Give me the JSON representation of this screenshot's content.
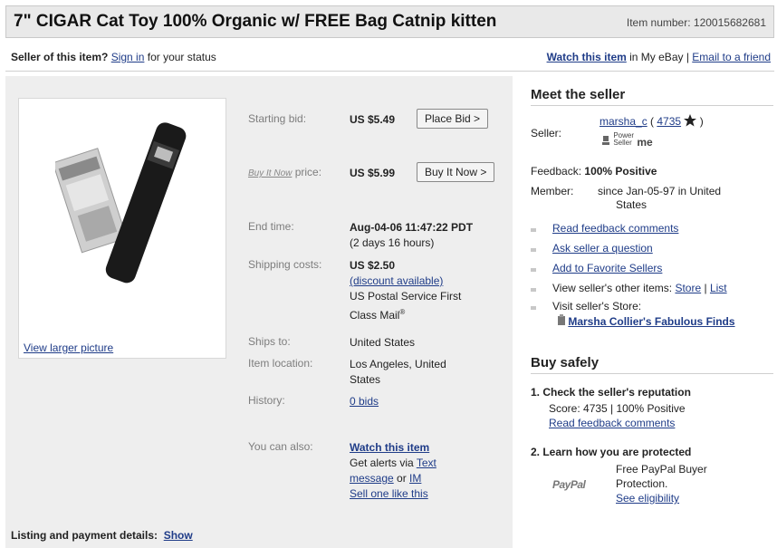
{
  "header": {
    "title": "7\" CIGAR Cat Toy 100% Organic w/ FREE Bag Catnip kitten",
    "item_number_label": "Item number:",
    "item_number": "120015682681"
  },
  "status_bar": {
    "seller_prompt": "Seller of this item?",
    "sign_in": "Sign in",
    "status_suffix": " for your status",
    "watch_link": "Watch this item",
    "watch_suffix": " in My eBay | ",
    "email_link": "Email to a friend"
  },
  "photo": {
    "view_larger": "View larger picture"
  },
  "listing": {
    "starting_bid_label": "Starting bid:",
    "starting_bid": "US $5.49",
    "place_bid": "Place Bid >",
    "buy_it_now_logo": "Buy It Now",
    "price_label": "price:",
    "price": "US $5.99",
    "buy_it_now_button": "Buy It Now >",
    "end_time_label": "End time:",
    "end_time": "Aug-04-06 11:47:22 PDT",
    "time_left": "(2 days 16 hours)",
    "shipping_label": "Shipping costs:",
    "shipping_cost": "US $2.50",
    "discount_link": "(discount available)",
    "shipping_service_1": "US Postal Service First",
    "shipping_service_2": "Class Mail",
    "registered_mark": "®",
    "ships_to_label": "Ships to:",
    "ships_to": "United States",
    "location_label": "Item location:",
    "location_1": "Los Angeles, United",
    "location_2": "States",
    "history_label": "History:",
    "bids_link": "0 bids",
    "you_can_also_label": "You can also:",
    "watch_link": "Watch this item",
    "alerts_text": "Get alerts via ",
    "text_link": "Text",
    "message_link": "message",
    "or_text": " or ",
    "im_link": "IM",
    "sell_one_link": "Sell one like this"
  },
  "details": {
    "label": "Listing and payment details:",
    "show_link": "Show"
  },
  "meet_seller": {
    "heading": "Meet the seller",
    "seller_label": "Seller:",
    "seller_name": "marsha_c",
    "seller_score": "4735",
    "power_seller_1": "Power",
    "power_seller_2": "Seller",
    "me_badge": "me",
    "feedback_label": "Feedback:",
    "feedback_value": "100% Positive",
    "member_label": "Member:",
    "member_value_1": "since Jan-05-97 in United",
    "member_value_2": "States",
    "read_feedback": "Read feedback comments",
    "ask_question": "Ask seller a question",
    "add_favorite": "Add to Favorite Sellers",
    "other_items": "View seller's other items: ",
    "store_link": "Store",
    "list_link": "List",
    "visit_store": "Visit seller's Store:",
    "store_name": "Marsha Collier's Fabulous Finds"
  },
  "buy_safely": {
    "heading": "Buy safely",
    "step1_title": "1.  Check the seller's reputation",
    "step1_score": "Score: 4735 | 100% Positive",
    "step1_link": "Read feedback comments",
    "step2_title": "2.  Learn how you are protected",
    "paypal_logo": "PayPal",
    "paypal_text_1": "Free PayPal Buyer",
    "paypal_text_2": "Protection.",
    "see_eligibility": "See eligibility"
  },
  "colors": {
    "link": "#1f3c88",
    "panel": "#eeeeee",
    "title_bar": "#e9e9e9"
  }
}
